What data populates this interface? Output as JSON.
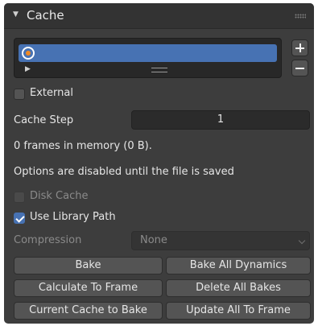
{
  "panel": {
    "title": "Cache",
    "collapse_icon": "triangle-down-icon"
  },
  "list": {
    "item_icon": "point-cache-icon",
    "add_icon": "plus-icon",
    "remove_icon": "minus-icon"
  },
  "fields": {
    "external_label": "External",
    "external_checked": false,
    "cache_step_label": "Cache Step",
    "cache_step_value": "1",
    "frames_info": "0 frames in memory (0 B).",
    "disabled_notice": "Options are disabled until the file is saved",
    "disk_cache_label": "Disk Cache",
    "disk_cache_checked": false,
    "library_path_label": "Use Library Path",
    "library_path_checked": true,
    "compression_label": "Compression",
    "compression_value": "None"
  },
  "buttons": {
    "bake": "Bake",
    "bake_all_dynamics": "Bake All Dynamics",
    "calculate_to_frame": "Calculate To Frame",
    "delete_all_bakes": "Delete All Bakes",
    "current_cache_to_bake": "Current Cache to Bake",
    "update_all_to_frame": "Update All To Frame"
  },
  "colors": {
    "panel_bg": "#3d3d3d",
    "header_bg": "#333333",
    "accent": "#4772b3",
    "button_bg": "#545454",
    "field_bg": "#2b2b2b"
  }
}
